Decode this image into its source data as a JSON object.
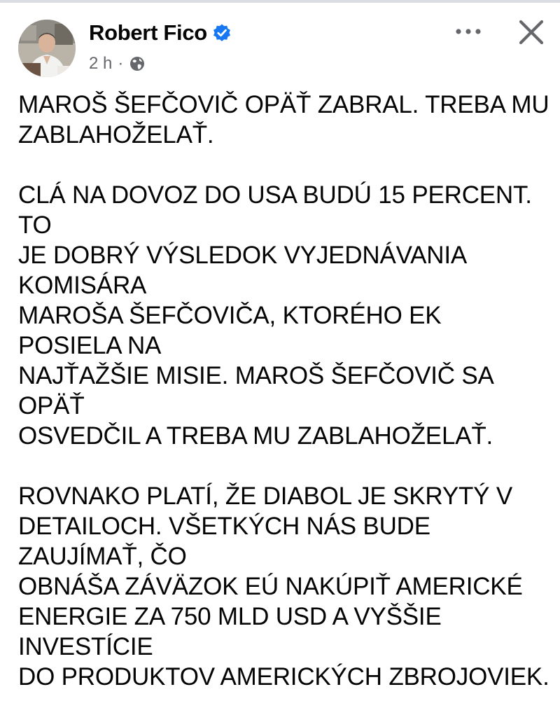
{
  "post": {
    "author": "Robert Fico",
    "verified": true,
    "time": "2 h",
    "meta_separator": "·",
    "audience_icon": "globe-icon",
    "actions": {
      "more_icon": "more-horizontal-icon",
      "close_icon": "close-icon"
    },
    "paragraphs": [
      "MAROŠ ŠEFČOVIČ OPÄŤ ZABRAL. TREBA MU\nZABLAHOŽELAŤ.",
      "CLÁ NA DOVOZ DO USA BUDÚ 15 PERCENT. TO\nJE DOBRÝ VÝSLEDOK VYJEDNÁVANIA KOMISÁRA\nMAROŠA ŠEFČOVIČA, KTORÉHO EK POSIELA NA\nNAJŤAŽŠIE MISIE. MAROŠ ŠEFČOVIČ SA OPÄŤ\nOSVEDČIL A TREBA MU ZABLAHOŽELAŤ.",
      "ROVNAKO PLATÍ, ŽE DIABOL JE SKRYTÝ V\nDETAILOCH. VŠETKÝCH NÁS BUDE ZAUJÍMAŤ, ČO\nOBNÁŠA ZÁVÄZOK EÚ NAKÚPIŤ AMERICKÉ\nENERGIE ZA 750 MLD USD A VYŠŠIE INVESTÍCIE\nDO PRODUKTOV AMERICKÝCH ZBROJOVIEK."
    ]
  },
  "colors": {
    "verified_blue": "#1877f2",
    "meta_gray": "#65676b",
    "text": "#050505"
  }
}
